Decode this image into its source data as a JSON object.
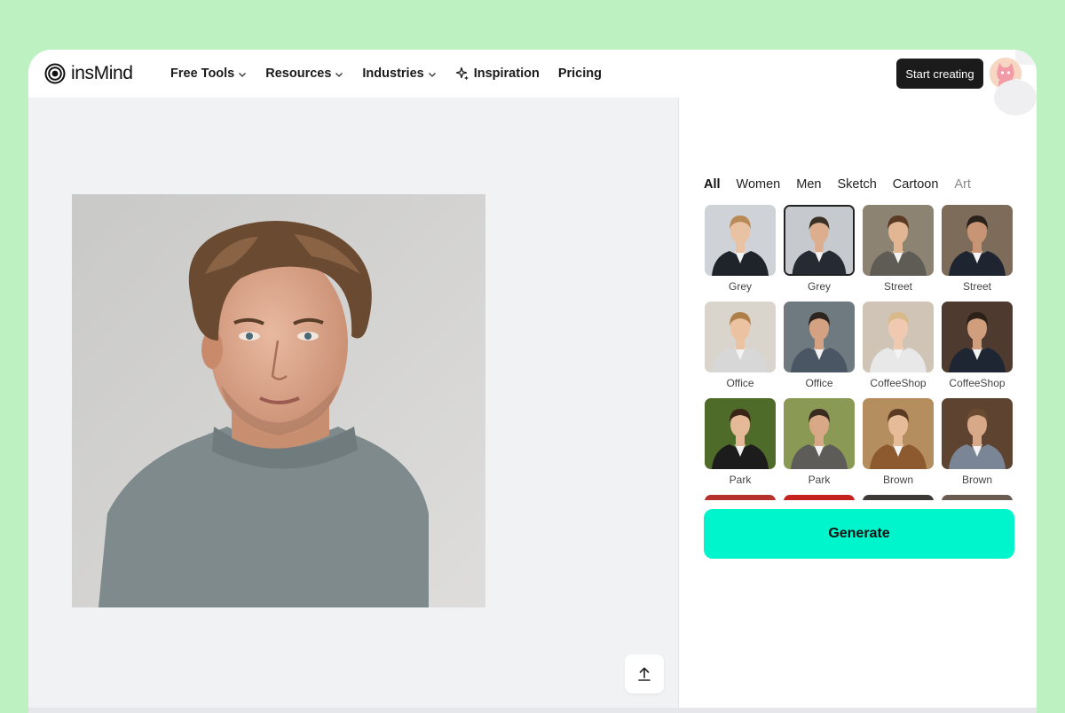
{
  "brand": {
    "name": "insMind",
    "icon": "spiral-logo-icon"
  },
  "nav": {
    "items": [
      {
        "label": "Free Tools",
        "dropdown": true
      },
      {
        "label": "Resources",
        "dropdown": true
      },
      {
        "label": "Industries",
        "dropdown": true
      },
      {
        "label": "Inspiration",
        "icon": "sparkle-icon"
      },
      {
        "label": "Pricing"
      }
    ]
  },
  "header": {
    "cta_label": "Start creating",
    "avatar_icon": "cat-avatar-icon"
  },
  "canvas": {
    "upload_icon": "upload-arrow-icon"
  },
  "styles": {
    "tabs": [
      "All",
      "Women",
      "Men",
      "Sketch",
      "Cartoon",
      "Art"
    ],
    "active_tab": "All",
    "items": [
      {
        "label": "Grey",
        "bg": "#cfd2d6",
        "suit": "#1f242b",
        "skin": "#e9c2a4",
        "hair": "#b98a55",
        "selected": false
      },
      {
        "label": "Grey",
        "bg": "#c6c9cd",
        "suit": "#262b33",
        "skin": "#dcae8e",
        "hair": "#3b3026",
        "selected": true
      },
      {
        "label": "Street",
        "bg": "#8c8373",
        "suit": "#5f5b55",
        "skin": "#e2b593",
        "hair": "#5a3a22",
        "selected": false
      },
      {
        "label": "Street",
        "bg": "#7d6c59",
        "suit": "#1e2430",
        "skin": "#c89574",
        "hair": "#2a211a",
        "selected": false
      },
      {
        "label": "Office",
        "bg": "#d9d4cc",
        "suit": "#d7d7d7",
        "skin": "#ecc3a2",
        "hair": "#b07f49",
        "selected": false
      },
      {
        "label": "Office",
        "bg": "#6e7a80",
        "suit": "#4a5664",
        "skin": "#d4a283",
        "hair": "#2c241e",
        "selected": false
      },
      {
        "label": "CoffeeShop",
        "bg": "#cfc4b6",
        "suit": "#e8e8e8",
        "skin": "#efcab0",
        "hair": "#d8b98a",
        "selected": false
      },
      {
        "label": "CoffeeShop",
        "bg": "#4e3a2e",
        "suit": "#1f2633",
        "skin": "#d09e7d",
        "hair": "#2d2018",
        "selected": false
      },
      {
        "label": "Park",
        "bg": "#4f6b2a",
        "suit": "#1c1c1c",
        "skin": "#e5b898",
        "hair": "#3a2418",
        "selected": false
      },
      {
        "label": "Park",
        "bg": "#8a9a55",
        "suit": "#5d5c58",
        "skin": "#d9a987",
        "hair": "#3a2a1f",
        "selected": false
      },
      {
        "label": "Brown",
        "bg": "#b48e5e",
        "suit": "#8c5a2e",
        "skin": "#e6bb98",
        "hair": "#5a3a22",
        "selected": false
      },
      {
        "label": "Brown",
        "bg": "#5e4330",
        "suit": "#7a8696",
        "skin": "#d8a988",
        "hair": "#6a4a30",
        "selected": false
      },
      {
        "label": "",
        "bg": "#b5312b",
        "suit": "#222",
        "skin": "#e3b897",
        "hair": "#3a2418",
        "selected": false
      },
      {
        "label": "",
        "bg": "#c4221f",
        "suit": "#222",
        "skin": "#e3b897",
        "hair": "#3a2418",
        "selected": false
      },
      {
        "label": "",
        "bg": "#3d3a36",
        "suit": "#222",
        "skin": "#e3b897",
        "hair": "#3a2418",
        "selected": false
      },
      {
        "label": "",
        "bg": "#6a5c52",
        "suit": "#222",
        "skin": "#e3b897",
        "hair": "#3a2418",
        "selected": false
      }
    ]
  },
  "generate": {
    "label": "Generate"
  },
  "colors": {
    "accent": "#00f5cc",
    "page_bg": "#bdf1c2",
    "canvas_bg": "#f1f2f4",
    "cta_bg": "#1b1b1b"
  }
}
